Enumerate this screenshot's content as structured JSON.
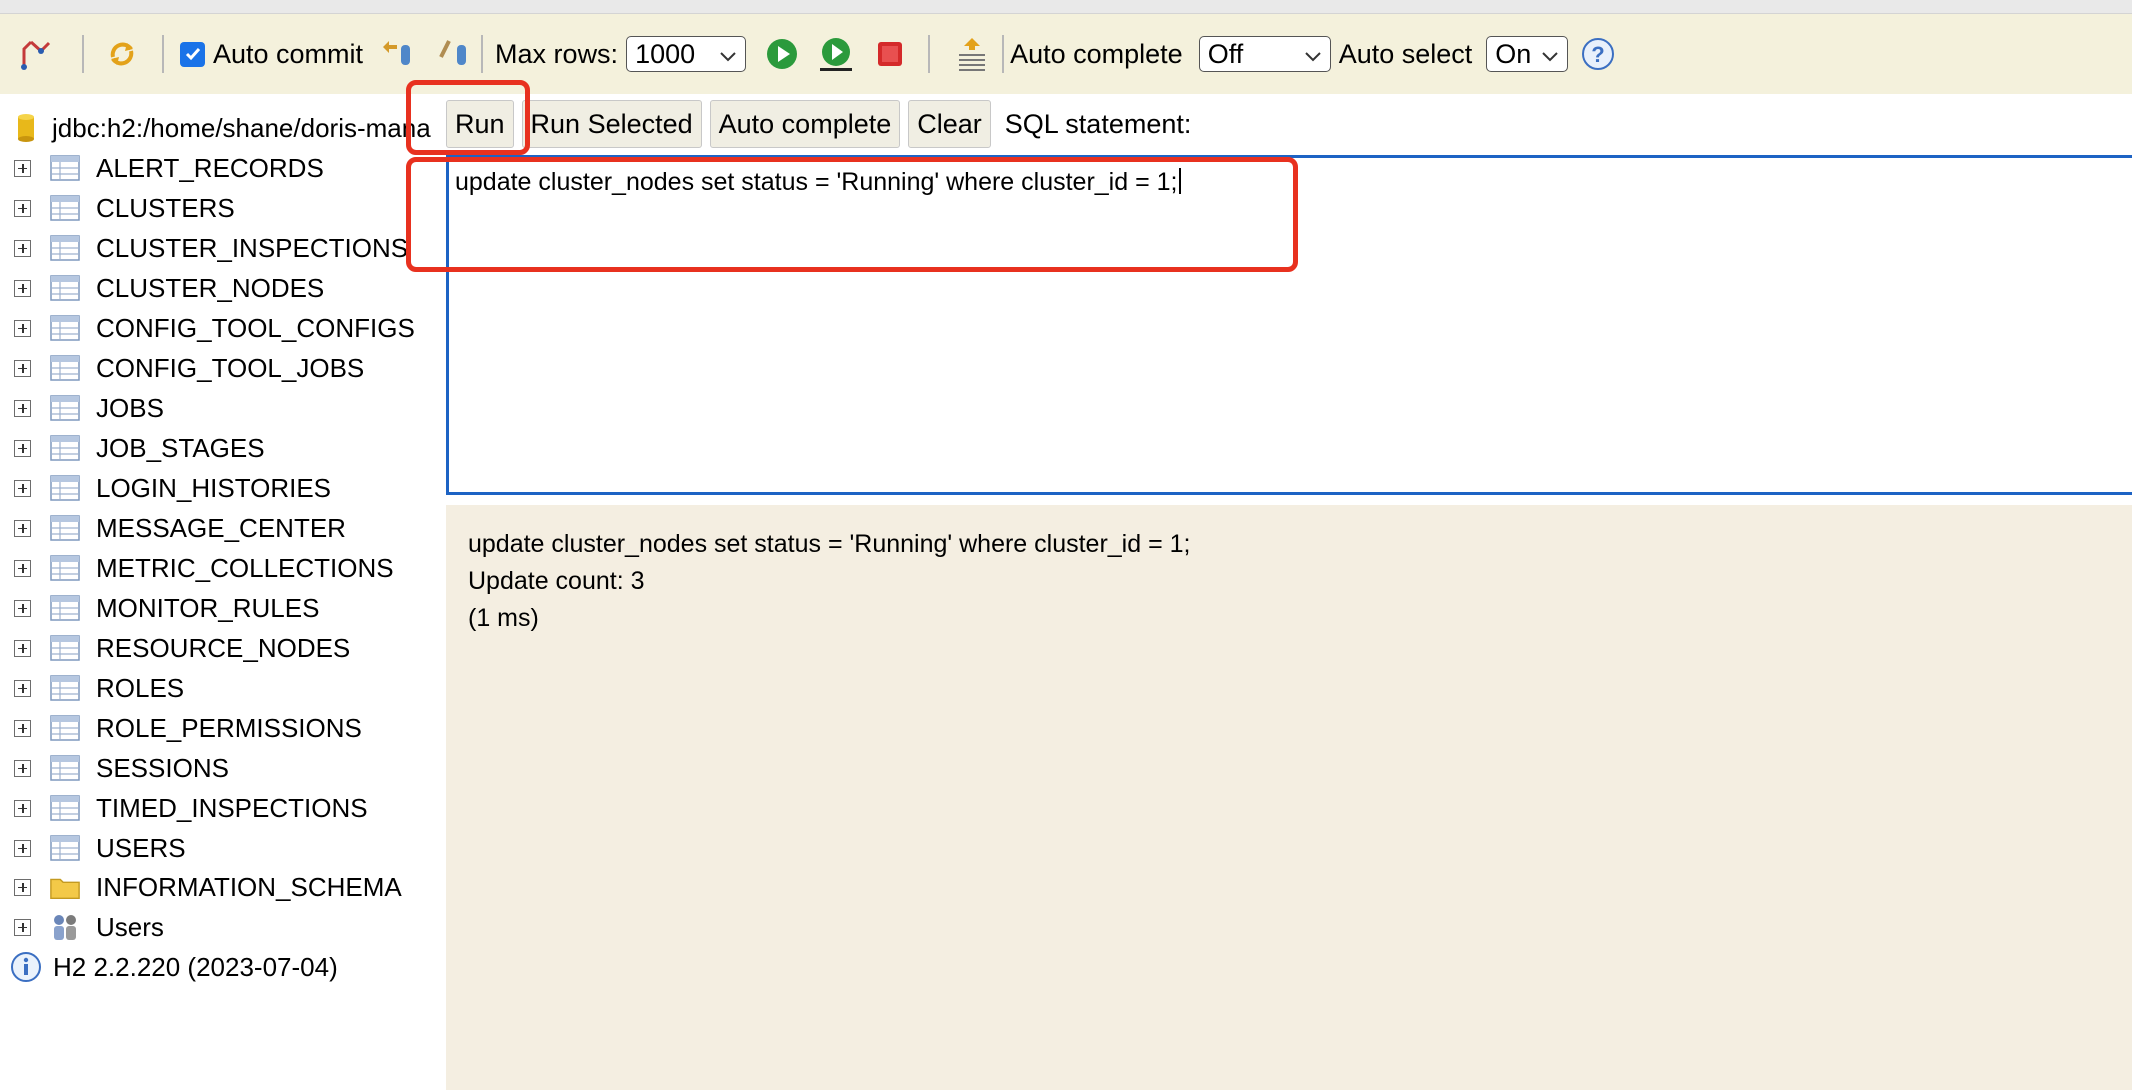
{
  "toolbar": {
    "auto_commit_label": "Auto commit",
    "max_rows_label": "Max rows:",
    "max_rows_value": "1000",
    "auto_complete_label": "Auto complete",
    "auto_complete_value": "Off",
    "auto_select_label": "Auto select",
    "auto_select_value": "On"
  },
  "tree": {
    "connection": "jdbc:h2:/home/shane/doris-mana",
    "tables": [
      "ALERT_RECORDS",
      "CLUSTERS",
      "CLUSTER_INSPECTIONS",
      "CLUSTER_NODES",
      "CONFIG_TOOL_CONFIGS",
      "CONFIG_TOOL_JOBS",
      "JOBS",
      "JOB_STAGES",
      "LOGIN_HISTORIES",
      "MESSAGE_CENTER",
      "METRIC_COLLECTIONS",
      "MONITOR_RULES",
      "RESOURCE_NODES",
      "ROLES",
      "ROLE_PERMISSIONS",
      "SESSIONS",
      "TIMED_INSPECTIONS",
      "USERS"
    ],
    "schema": "INFORMATION_SCHEMA",
    "users": "Users",
    "version": "H2 2.2.220 (2023-07-04)"
  },
  "buttons": {
    "run": "Run",
    "run_selected": "Run Selected",
    "auto_complete": "Auto complete",
    "clear": "Clear",
    "sql_label": "SQL statement:"
  },
  "editor": {
    "text": "update cluster_nodes set status = 'Running' where cluster_id = 1;"
  },
  "result": {
    "statement": "update cluster_nodes set status = 'Running' where cluster_id = 1;",
    "update_count": "Update count: 3",
    "duration": "(1 ms)"
  },
  "colors": {
    "toolbar_bg": "#f4f1dc",
    "result_bg": "#f4eee1",
    "editor_border": "#1d63c4",
    "highlight": "#e8311f"
  }
}
